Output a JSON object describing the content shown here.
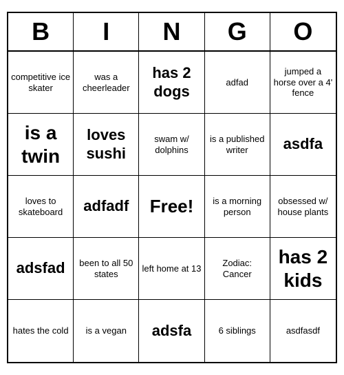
{
  "header": {
    "letters": [
      "B",
      "I",
      "N",
      "G",
      "O"
    ]
  },
  "cells": [
    {
      "text": "competitive ice skater",
      "size": "normal"
    },
    {
      "text": "was a cheerleader",
      "size": "normal"
    },
    {
      "text": "has 2 dogs",
      "size": "large"
    },
    {
      "text": "adfad",
      "size": "normal"
    },
    {
      "text": "jumped a horse over a 4' fence",
      "size": "normal"
    },
    {
      "text": "is a twin",
      "size": "extra-large"
    },
    {
      "text": "loves sushi",
      "size": "large"
    },
    {
      "text": "swam w/ dolphins",
      "size": "normal"
    },
    {
      "text": "is a published writer",
      "size": "normal"
    },
    {
      "text": "asdfa",
      "size": "large"
    },
    {
      "text": "loves to skateboard",
      "size": "normal"
    },
    {
      "text": "adfadf",
      "size": "large"
    },
    {
      "text": "Free!",
      "size": "free"
    },
    {
      "text": "is a morning person",
      "size": "normal"
    },
    {
      "text": "obsessed w/ house plants",
      "size": "normal"
    },
    {
      "text": "adsfad",
      "size": "large"
    },
    {
      "text": "been to all 50 states",
      "size": "normal"
    },
    {
      "text": "left home at 13",
      "size": "normal"
    },
    {
      "text": "Zodiac: Cancer",
      "size": "normal"
    },
    {
      "text": "has 2 kids",
      "size": "extra-large"
    },
    {
      "text": "hates the cold",
      "size": "normal"
    },
    {
      "text": "is a vegan",
      "size": "normal"
    },
    {
      "text": "adsfa",
      "size": "large"
    },
    {
      "text": "6 siblings",
      "size": "normal"
    },
    {
      "text": "asdfasdf",
      "size": "normal"
    }
  ]
}
